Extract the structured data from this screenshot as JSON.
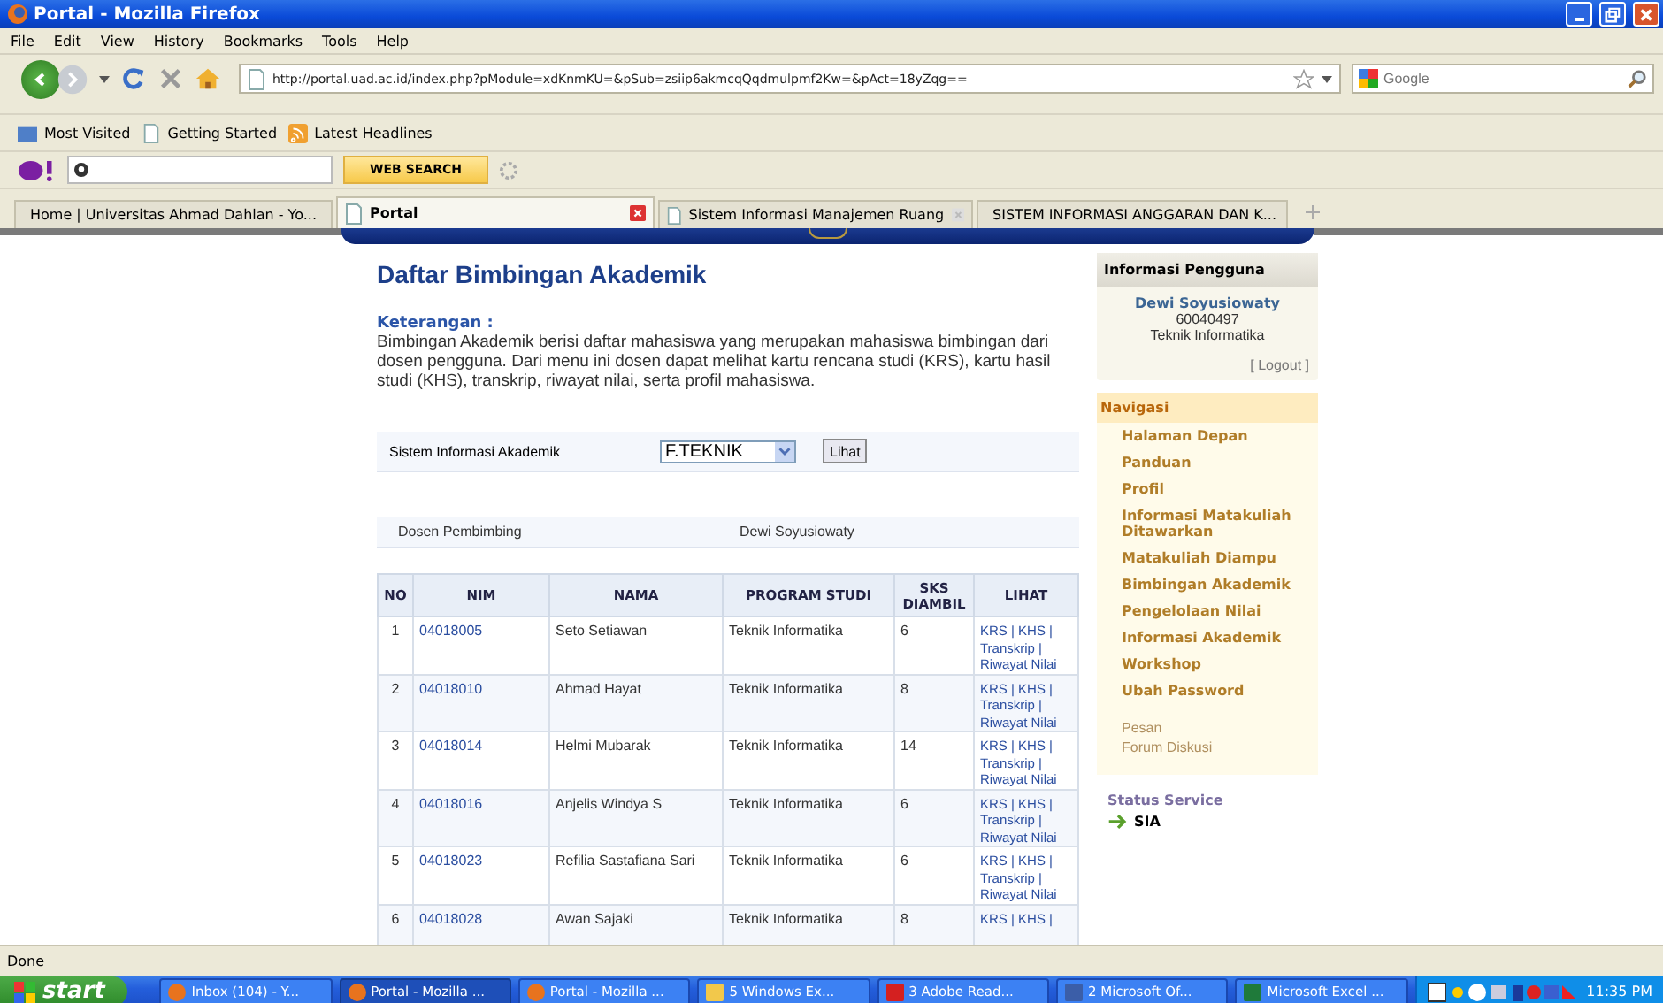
{
  "window": {
    "title": "Portal - Mozilla Firefox"
  },
  "menu": [
    "File",
    "Edit",
    "View",
    "History",
    "Bookmarks",
    "Tools",
    "Help"
  ],
  "address": {
    "value": "http://portal.uad.ac.id/index.php?pModule=xdKnmKU=&pSub=zsiip6akmcqQqdmulpmf2Kw=&pAct=18yZqg=="
  },
  "search": {
    "placeholder": "Google"
  },
  "bookmarks": [
    "Most Visited",
    "Getting Started",
    "Latest Headlines"
  ],
  "yahoo": {
    "button": "WEB SEARCH"
  },
  "tabs": [
    {
      "label": "Home | Universitas Ahmad Dahlan - Yo...",
      "selected": false
    },
    {
      "label": "Portal",
      "selected": true
    },
    {
      "label": "Sistem Informasi Manajemen Ruang",
      "selected": false
    },
    {
      "label": "SISTEM INFORMASI ANGGARAN DAN K...",
      "selected": false
    }
  ],
  "page": {
    "title": "Daftar Bimbingan Akademik",
    "note_label": "Keterangan :",
    "note": "Bimbingan Akademik berisi daftar mahasiswa yang merupakan mahasiswa bimbingan dari dosen pengguna. Dari menu ini dosen dapat melihat kartu rencana studi (KRS), kartu hasil studi (KHS), transkrip, riwayat nilai, serta profil mahasiswa.",
    "filter": {
      "label": "Sistem Informasi Akademik",
      "value": "F.TEKNIK",
      "button": "Lihat"
    },
    "advisor": {
      "label": "Dosen Pembimbing",
      "value": "Dewi Soyusiowaty"
    }
  },
  "table": {
    "columns": [
      "NO",
      "NIM",
      "NAMA",
      "PROGRAM STUDI",
      "SKS DIAMBIL",
      "LIHAT"
    ],
    "rows": [
      {
        "no": "1",
        "nim": "04018005",
        "nama": "Seto Setiawan",
        "prodi": "Teknik Informatika",
        "sks": "6",
        "lihat": [
          "KRS |",
          "KHS |",
          "Transkrip |",
          "Riwayat Nilai"
        ]
      },
      {
        "no": "2",
        "nim": "04018010",
        "nama": "Ahmad Hayat",
        "prodi": "Teknik Informatika",
        "sks": "8",
        "lihat": [
          "KRS |",
          "KHS |",
          "Transkrip |",
          "Riwayat Nilai"
        ]
      },
      {
        "no": "3",
        "nim": "04018014",
        "nama": "Helmi Mubarak",
        "prodi": "Teknik Informatika",
        "sks": "14",
        "lihat": [
          "KRS |",
          "KHS |",
          "Transkrip |",
          "Riwayat Nilai"
        ]
      },
      {
        "no": "4",
        "nim": "04018016",
        "nama": "Anjelis Windya S",
        "prodi": "Teknik Informatika",
        "sks": "6",
        "lihat": [
          "KRS |",
          "KHS |",
          "Transkrip |",
          "Riwayat Nilai"
        ]
      },
      {
        "no": "5",
        "nim": "04018023",
        "nama": "Refilia Sastafiana Sari",
        "prodi": "Teknik Informatika",
        "sks": "6",
        "lihat": [
          "KRS |",
          "KHS |",
          "Transkrip |",
          "Riwayat Nilai"
        ]
      },
      {
        "no": "6",
        "nim": "04018028",
        "nama": "Awan Sajaki",
        "prodi": "Teknik Informatika",
        "sks": "8",
        "lihat": [
          "KRS |",
          "KHS |"
        ]
      }
    ]
  },
  "user_info": {
    "title": "Informasi Pengguna",
    "name": "Dewi Soyusiowaty",
    "id": "60040497",
    "dept": "Teknik Informatika",
    "logout": "[ Logout ]"
  },
  "navigation": {
    "title": "Navigasi",
    "items": [
      "Halaman Depan",
      "Panduan",
      "Profil",
      "Informasi Matakuliah Ditawarkan",
      "Matakuliah Diampu",
      "Bimbingan Akademik",
      "Pengelolaan Nilai",
      "Informasi Akademik",
      "Workshop",
      "Ubah Password"
    ],
    "links": [
      "Pesan",
      "Forum Diskusi"
    ]
  },
  "status_service": {
    "title": "Status Service",
    "items": [
      "SIA"
    ]
  },
  "status_bar": "Done",
  "taskbar": {
    "start": "start",
    "items": [
      {
        "label": "Inbox (104) - Y...",
        "kind": "firefox",
        "selected": false
      },
      {
        "label": "Portal - Mozilla ...",
        "kind": "firefox",
        "selected": true
      },
      {
        "label": "Portal - Mozilla ...",
        "kind": "firefox",
        "selected": false
      },
      {
        "label": "5 Windows Ex...",
        "kind": "folder",
        "selected": false
      },
      {
        "label": "3 Adobe Read...",
        "kind": "pdf",
        "selected": false
      },
      {
        "label": "2 Microsoft Of...",
        "kind": "office",
        "selected": false
      },
      {
        "label": "Microsoft Excel ...",
        "kind": "excel",
        "selected": false
      }
    ],
    "clock": "11:35 PM"
  }
}
